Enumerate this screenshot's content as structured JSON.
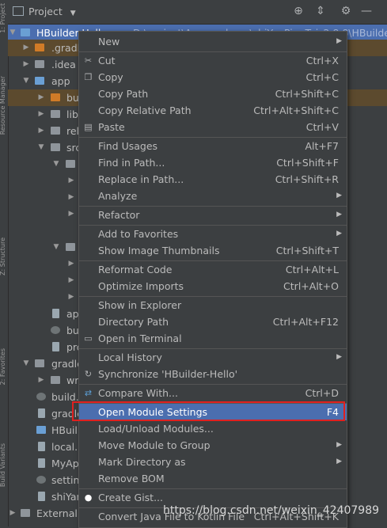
{
  "left_strip": {
    "labels": [
      "1: Project",
      "Resource Manager",
      "Z: Structure",
      "2: Favorites",
      "Build Variants"
    ]
  },
  "toolbar": {
    "title": "Project",
    "icons": [
      "target-icon",
      "collapse-icon",
      "gear-icon",
      "minimize-icon"
    ]
  },
  "tree": {
    "root_label": "HBuilder-Hello",
    "root_path": "D:\\project\\App-package\\shiYanPingTai_2.8.8\\HBuilder-He",
    "items": [
      {
        "label": ".gradl"
      },
      {
        "label": ".idea"
      },
      {
        "label": "app"
      },
      {
        "label": "bu"
      },
      {
        "label": "libs"
      },
      {
        "label": "rel"
      },
      {
        "label": "src"
      },
      {
        "label": "ap"
      },
      {
        "label": "bu"
      },
      {
        "label": "pro"
      },
      {
        "label": "gradle"
      },
      {
        "label": "wra"
      },
      {
        "label": "build."
      },
      {
        "label": "gradle"
      },
      {
        "label": "HBuil"
      },
      {
        "label": "local."
      },
      {
        "label": "MyAp"
      },
      {
        "label": "setting"
      },
      {
        "label": "shiYar"
      },
      {
        "label": "External L"
      }
    ]
  },
  "menu": {
    "items": [
      {
        "label": "New",
        "shortcut": "",
        "submenu": true
      },
      {
        "label": "Cut",
        "shortcut": "Ctrl+X"
      },
      {
        "label": "Copy",
        "shortcut": "Ctrl+C"
      },
      {
        "label": "Copy Path",
        "shortcut": "Ctrl+Shift+C"
      },
      {
        "label": "Copy Relative Path",
        "shortcut": "Ctrl+Alt+Shift+C"
      },
      {
        "label": "Paste",
        "shortcut": "Ctrl+V"
      },
      {
        "label": "Find Usages",
        "shortcut": "Alt+F7"
      },
      {
        "label": "Find in Path...",
        "shortcut": "Ctrl+Shift+F"
      },
      {
        "label": "Replace in Path...",
        "shortcut": "Ctrl+Shift+R"
      },
      {
        "label": "Analyze",
        "shortcut": "",
        "submenu": true
      },
      {
        "label": "Refactor",
        "shortcut": "",
        "submenu": true
      },
      {
        "label": "Add to Favorites",
        "shortcut": "",
        "submenu": true
      },
      {
        "label": "Show Image Thumbnails",
        "shortcut": "Ctrl+Shift+T"
      },
      {
        "label": "Reformat Code",
        "shortcut": "Ctrl+Alt+L"
      },
      {
        "label": "Optimize Imports",
        "shortcut": "Ctrl+Alt+O"
      },
      {
        "label": "Show in Explorer",
        "shortcut": ""
      },
      {
        "label": "Directory Path",
        "shortcut": "Ctrl+Alt+F12"
      },
      {
        "label": "Open in Terminal",
        "shortcut": ""
      },
      {
        "label": "Local History",
        "shortcut": "",
        "submenu": true
      },
      {
        "label": "Synchronize 'HBuilder-Hello'",
        "shortcut": ""
      },
      {
        "label": "Compare With...",
        "shortcut": "Ctrl+D"
      },
      {
        "label": "Open Module Settings",
        "shortcut": "F4"
      },
      {
        "label": "Load/Unload Modules...",
        "shortcut": ""
      },
      {
        "label": "Move Module to Group",
        "shortcut": "",
        "submenu": true
      },
      {
        "label": "Mark Directory as",
        "shortcut": "",
        "submenu": true
      },
      {
        "label": "Remove BOM",
        "shortcut": ""
      },
      {
        "label": "Create Gist...",
        "shortcut": ""
      },
      {
        "label": "Convert Java File to Kotlin File",
        "shortcut": "Ctrl+Alt+Shift+K"
      }
    ]
  },
  "watermark": "https://blog.csdn.net/weixin_42407989",
  "colors": {
    "selection": "#4b6eaf",
    "highlight_box": "#e0201f",
    "background": "#3c3f41"
  }
}
